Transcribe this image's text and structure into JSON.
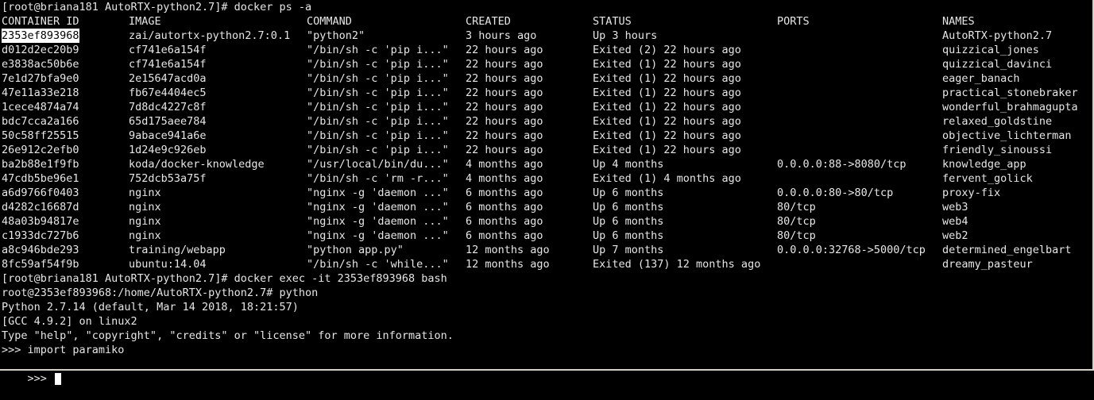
{
  "colors": {
    "background": "#000000",
    "foreground": "#e6e6e6",
    "selection": "#ffffff"
  },
  "prompt_line": "[root@briana181 AutoRTX-python2.7]# docker ps -a",
  "headers": {
    "id": "CONTAINER ID",
    "image": "IMAGE",
    "command": "COMMAND",
    "created": "CREATED",
    "status": "STATUS",
    "ports": "PORTS",
    "names": "NAMES"
  },
  "containers": [
    {
      "id": "2353ef893968",
      "image": "zai/autortx-python2.7:0.1",
      "command": "\"python2\"",
      "created": "3 hours ago",
      "status": "Up 3 hours",
      "ports": "",
      "names": "AutoRTX-python2.7"
    },
    {
      "id": "d012d2ec20b9",
      "image": "cf741e6a154f",
      "command": "\"/bin/sh -c 'pip i...\"",
      "created": "22 hours ago",
      "status": "Exited (2) 22 hours ago",
      "ports": "",
      "names": "quizzical_jones"
    },
    {
      "id": "e3838ac50b6e",
      "image": "cf741e6a154f",
      "command": "\"/bin/sh -c 'pip i...\"",
      "created": "22 hours ago",
      "status": "Exited (1) 22 hours ago",
      "ports": "",
      "names": "quizzical_davinci"
    },
    {
      "id": "7e1d27bfa9e0",
      "image": "2e15647acd0a",
      "command": "\"/bin/sh -c 'pip i...\"",
      "created": "22 hours ago",
      "status": "Exited (1) 22 hours ago",
      "ports": "",
      "names": "eager_banach"
    },
    {
      "id": "47e11a33e218",
      "image": "fb67e4404ec5",
      "command": "\"/bin/sh -c 'pip i...\"",
      "created": "22 hours ago",
      "status": "Exited (1) 22 hours ago",
      "ports": "",
      "names": "practical_stonebraker"
    },
    {
      "id": "1cece4874a74",
      "image": "7d8dc4227c8f",
      "command": "\"/bin/sh -c 'pip i...\"",
      "created": "22 hours ago",
      "status": "Exited (1) 22 hours ago",
      "ports": "",
      "names": "wonderful_brahmagupta"
    },
    {
      "id": "bdc7cca2a166",
      "image": "65d175aee784",
      "command": "\"/bin/sh -c 'pip i...\"",
      "created": "22 hours ago",
      "status": "Exited (1) 22 hours ago",
      "ports": "",
      "names": "relaxed_goldstine"
    },
    {
      "id": "50c58ff25515",
      "image": "9abace941a6e",
      "command": "\"/bin/sh -c 'pip i...\"",
      "created": "22 hours ago",
      "status": "Exited (1) 22 hours ago",
      "ports": "",
      "names": "objective_lichterman"
    },
    {
      "id": "26e912c2efb0",
      "image": "1d24e9c926eb",
      "command": "\"/bin/sh -c 'pip i...\"",
      "created": "22 hours ago",
      "status": "Exited (1) 22 hours ago",
      "ports": "",
      "names": "friendly_sinoussi"
    },
    {
      "id": "ba2b88e1f9fb",
      "image": "koda/docker-knowledge",
      "command": "\"/usr/local/bin/du...\"",
      "created": "4 months ago",
      "status": "Up 4 months",
      "ports": "0.0.0.0:88->8080/tcp",
      "names": "knowledge_app"
    },
    {
      "id": "47cdb5be96e1",
      "image": "752dcb53a75f",
      "command": "\"/bin/sh -c 'rm -r...\"",
      "created": "4 months ago",
      "status": "Exited (1) 4 months ago",
      "ports": "",
      "names": "fervent_golick"
    },
    {
      "id": "a6d9766f0403",
      "image": "nginx",
      "command": "\"nginx -g 'daemon ...\"",
      "created": "6 months ago",
      "status": "Up 6 months",
      "ports": "0.0.0.0:80->80/tcp",
      "names": "proxy-fix"
    },
    {
      "id": "d4282c16687d",
      "image": "nginx",
      "command": "\"nginx -g 'daemon ...\"",
      "created": "6 months ago",
      "status": "Up 6 months",
      "ports": "80/tcp",
      "names": "web3"
    },
    {
      "id": "48a03b94817e",
      "image": "nginx",
      "command": "\"nginx -g 'daemon ...\"",
      "created": "6 months ago",
      "status": "Up 6 months",
      "ports": "80/tcp",
      "names": "web4"
    },
    {
      "id": "c1933dc727b6",
      "image": "nginx",
      "command": "\"nginx -g 'daemon ...\"",
      "created": "6 months ago",
      "status": "Up 6 months",
      "ports": "80/tcp",
      "names": "web2"
    },
    {
      "id": "a8c946bde293",
      "image": "training/webapp",
      "command": "\"python app.py\"",
      "created": "12 months ago",
      "status": "Up 7 months",
      "ports": "0.0.0.0:32768->5000/tcp",
      "names": "determined_engelbart"
    },
    {
      "id": "8fc59af54f9b",
      "image": "ubuntu:14.04",
      "command": "\"/bin/sh -c 'while...\"",
      "created": "12 months ago",
      "status": "Exited (137) 12 months ago",
      "ports": "",
      "names": "dreamy_pasteur"
    }
  ],
  "trailing_lines": [
    "[root@briana181 AutoRTX-python2.7]# docker exec -it 2353ef893968 bash",
    "root@2353ef893968:/home/AutoRTX-python2.7# python",
    "Python 2.7.14 (default, Mar 14 2018, 18:21:57)",
    "[GCC 4.9.2] on linux2",
    "Type \"help\", \"copyright\", \"credits\" or \"license\" for more information.",
    ">>> import paramiko"
  ],
  "current_prompt": ">>> "
}
